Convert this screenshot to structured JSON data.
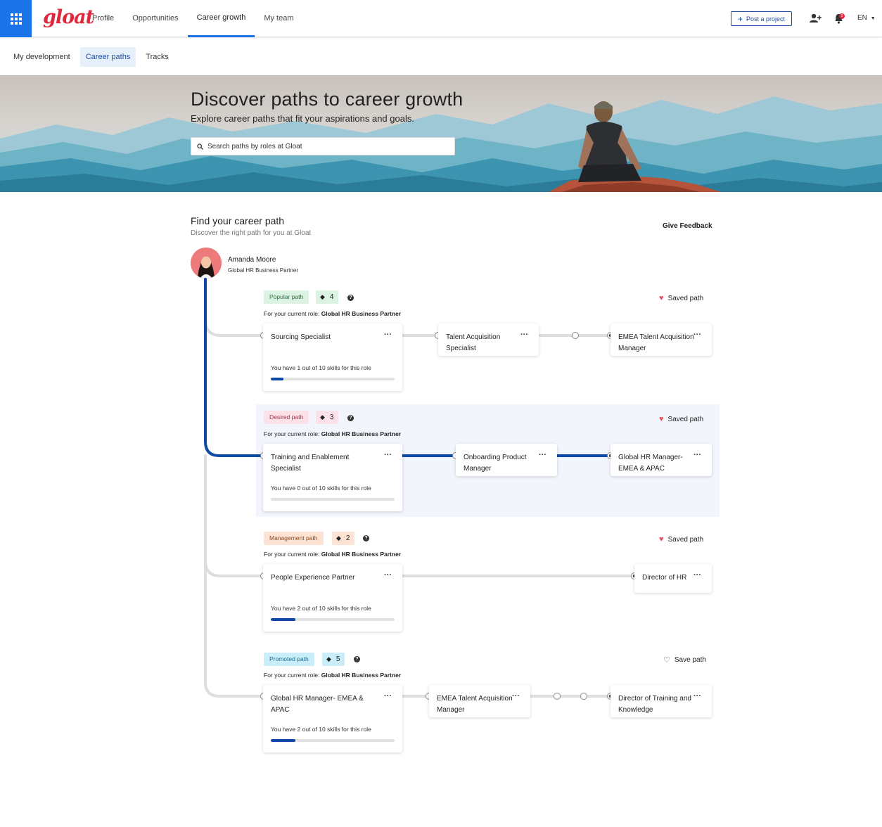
{
  "header": {
    "logo": "gloat",
    "nav": [
      "Profile",
      "Opportunities",
      "Career growth",
      "My team"
    ],
    "active_nav": "Career growth",
    "post_button": "Post a project",
    "notification_count": "3",
    "language": "EN"
  },
  "subnav": {
    "items": [
      "My development",
      "Career paths",
      "Tracks"
    ],
    "active": "Career paths"
  },
  "hero": {
    "title": "Discover paths to career growth",
    "subtitle": "Explore career paths that fit your aspirations and goals.",
    "search_placeholder": "Search paths by roles at Gloat"
  },
  "main": {
    "title": "Find your career path",
    "subtitle": "Discover the right path for you at Gloat",
    "feedback": "Give Feedback",
    "user": {
      "name": "Amanda Moore",
      "role": "Global HR Business Partner"
    },
    "current_role_prefix": "For your current role: ",
    "current_role": "Global HR Business Partner",
    "paths": [
      {
        "tag": "Popular path",
        "count": "4",
        "saved": "Saved path",
        "card1": {
          "title": "Sourcing Specialist",
          "skills": "You have 1 out of 10 skills for this role",
          "progress": 0.1
        },
        "card2": {
          "title": "Talent Acquisition Specialist"
        },
        "card3": {
          "title": "EMEA Talent Acquisition Manager"
        }
      },
      {
        "tag": "Desired path",
        "count": "3",
        "saved": "Saved path",
        "card1": {
          "title": "Training and Enablement Specialist",
          "skills": "You have 0 out of 10 skills for this role",
          "progress": 0
        },
        "card2": {
          "title": "Onboarding Product Manager"
        },
        "card3": {
          "title": "Global HR Manager- EMEA & APAC"
        }
      },
      {
        "tag": "Management path",
        "count": "2",
        "saved": "Saved path",
        "card1": {
          "title": "People Experience Partner",
          "skills": "You have 2 out of 10 skills for this role",
          "progress": 0.2
        },
        "card3": {
          "title": "Director of HR"
        }
      },
      {
        "tag": "Promoted path",
        "count": "5",
        "saved": "Save path",
        "card1": {
          "title": "Global HR Manager- EMEA & APAC",
          "skills": "You have 2 out of 10 skills for this role",
          "progress": 0.2
        },
        "card2": {
          "title": "EMEA Talent Acquisition Manager"
        },
        "card3": {
          "title": "Director of Training and Knowledge"
        }
      }
    ]
  },
  "colors": {
    "brand_blue": "#1a73e8",
    "path_blue": "#0d4aa6",
    "logo_red": "#e0283c",
    "popular_tag": "#dcf3e3",
    "desired_tag": "#fce1e8",
    "management_tag": "#fde3d3",
    "promoted_tag": "#c9eef9"
  }
}
